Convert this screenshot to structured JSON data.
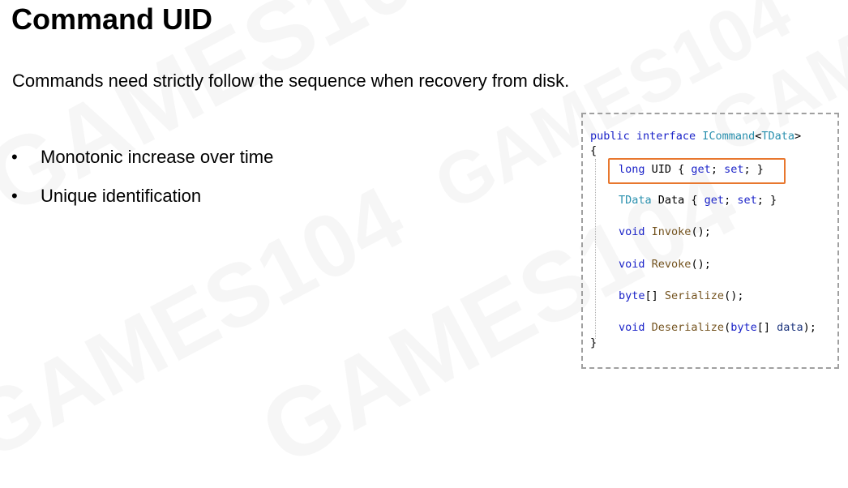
{
  "slide": {
    "title": "Command UID",
    "subtitle": "Commands need strictly follow the sequence when recovery from disk.",
    "bullets": [
      {
        "marker": "•",
        "text": "Monotonic increase over time"
      },
      {
        "marker": "•",
        "text": "Unique identification"
      }
    ]
  },
  "code": {
    "line1": {
      "kw1": "public",
      "kw2": "interface",
      "type1": "ICommand",
      "lt": "<",
      "type2": "TData",
      "gt": ">"
    },
    "open_brace": "{",
    "line_uid": {
      "kw": "long",
      "name": " UID { ",
      "get": "get",
      "sep": "; ",
      "set": "set",
      "end": "; }"
    },
    "line_data": {
      "type": "TData",
      "name": " Data { ",
      "get": "get",
      "sep": "; ",
      "set": "set",
      "end": "; }"
    },
    "line_invoke": {
      "kw": "void",
      "fn": "Invoke",
      "end": "();"
    },
    "line_revoke": {
      "kw": "void",
      "fn": "Revoke",
      "end": "();"
    },
    "line_serialize": {
      "kw": "byte",
      "arr": "[] ",
      "fn": "Serialize",
      "end": "();"
    },
    "line_deserialize": {
      "kw": "void",
      "fn": "Deserialize",
      "open": "(",
      "kw2": "byte",
      "arr": "[] ",
      "param": "data",
      "end": ");"
    },
    "close_brace": "}"
  },
  "colors": {
    "keyword": "#1a22c8",
    "type": "#2b91af",
    "method": "#74531f",
    "parameter": "#1f377f",
    "highlight_border": "#e8772e",
    "box_border": "#a0a0a0"
  }
}
